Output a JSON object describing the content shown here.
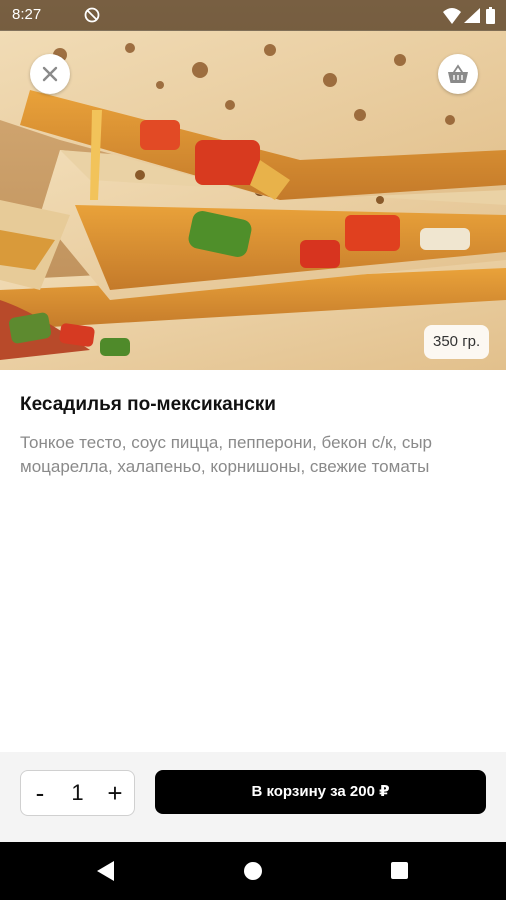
{
  "status_bar": {
    "time": "8:27",
    "icons": [
      "dnd-icon",
      "wifi-icon",
      "signal-icon",
      "battery-icon"
    ]
  },
  "hero": {
    "image": "quesadilla-photo",
    "close_icon": "close-icon",
    "cart_icon": "basket-icon",
    "weight": "350 гр."
  },
  "product": {
    "title": "Кесадилья по-мексикански",
    "description": "Тонкое тесто, соус пицца, пепперони, бекон с/к, сыр моцарелла, халапеньо, корнишоны, свежие томаты"
  },
  "order": {
    "minus_label": "-",
    "quantity": "1",
    "plus_label": "+",
    "add_to_cart_label": "В корзину за 200 ₽"
  },
  "nav_bar": {
    "icons": [
      "back-icon",
      "home-icon",
      "recents-icon"
    ]
  },
  "colors": {
    "accent": "#000000",
    "background": "#ffffff",
    "description_text": "#8a8a8a",
    "action_bar_bg": "#f4f4f4"
  }
}
